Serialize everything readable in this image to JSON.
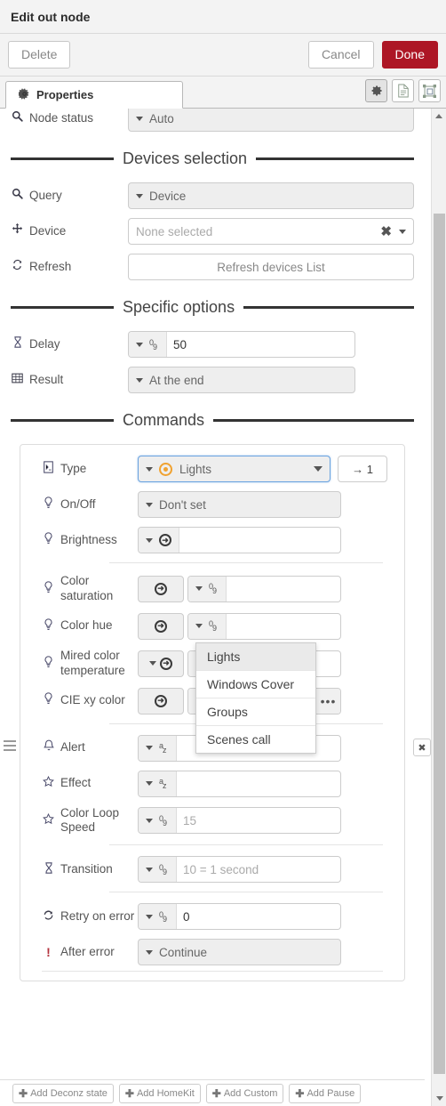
{
  "dialog": {
    "title": "Edit out node",
    "buttons": {
      "delete": "Delete",
      "cancel": "Cancel",
      "done": "Done"
    },
    "accent_color": "#ad1625"
  },
  "tabs": {
    "items": [
      {
        "label": "Properties",
        "icon": "gear-icon",
        "active": true
      }
    ],
    "tools": [
      {
        "name": "appearance-gear-icon",
        "active": true
      },
      {
        "name": "description-doc-icon",
        "active": false
      },
      {
        "name": "node-outline-icon",
        "active": false
      }
    ]
  },
  "form": {
    "node_status": {
      "label": "Node status",
      "icon": "search-icon",
      "value": "Auto"
    },
    "sections": [
      {
        "title": "Devices selection"
      },
      {
        "title": "Specific options"
      },
      {
        "title": "Commands"
      }
    ],
    "devices": {
      "query": {
        "label": "Query",
        "icon": "search-icon",
        "value": "Device"
      },
      "device": {
        "label": "Device",
        "icon": "move-icon",
        "placeholder": "None selected",
        "clear_icon": "close-icon"
      },
      "refresh": {
        "label": "Refresh",
        "icon": "refresh-icon",
        "button_label": "Refresh devices List"
      }
    },
    "specific": {
      "delay": {
        "label": "Delay",
        "icon": "hourglass-icon",
        "type": "num",
        "value": "50"
      },
      "result": {
        "label": "Result",
        "icon": "table-icon",
        "value": "At the end"
      }
    }
  },
  "command": {
    "type": {
      "label": "Type",
      "icon": "command-icon",
      "value": "Lights",
      "badge_icon": "deconz-orb-icon",
      "focused": true,
      "options": [
        "Lights",
        "Windows Cover",
        "Groups",
        "Scenes call"
      ],
      "selected_option": "Lights"
    },
    "goto_button": "→ 1",
    "rows": [
      {
        "label": "On/Off",
        "icon": "bulb-icon",
        "kind": "select",
        "value": "Don't set"
      },
      {
        "label": "Brightness",
        "icon": "bulb-icon",
        "kind": "select-arrow",
        "arrow_icon": "arrow-circle-icon",
        "value": ""
      },
      {
        "label": "Color saturation",
        "icon": "bulb-icon",
        "kind": "action-num",
        "arrow_icon": "arrow-circle-icon",
        "value": ""
      },
      {
        "label": "Color hue",
        "icon": "bulb-icon",
        "kind": "action-num",
        "arrow_icon": "arrow-circle-icon",
        "value": ""
      },
      {
        "label": "Mired color temperature",
        "icon": "bulb-icon",
        "kind": "select-arrow-num",
        "arrow_icon": "arrow-circle-icon",
        "value": ""
      },
      {
        "label": "CIE xy color",
        "icon": "bulb-icon",
        "kind": "action-json",
        "arrow_icon": "arrow-circle-icon",
        "type_glyph": "{}",
        "value": "[]",
        "more": "•••"
      },
      {
        "label": "Alert",
        "icon": "bell-icon",
        "kind": "text",
        "type_glyph": "az",
        "value": ""
      },
      {
        "label": "Effect",
        "icon": "star-icon",
        "kind": "text",
        "type_glyph": "az",
        "value": ""
      },
      {
        "label": "Color Loop Speed",
        "icon": "star-icon",
        "kind": "num",
        "placeholder": "15",
        "value": ""
      },
      {
        "label": "Transition",
        "icon": "hourglass-icon",
        "kind": "num",
        "placeholder": "10 = 1 second",
        "value": ""
      },
      {
        "label": "Retry on error",
        "icon": "refresh-icon",
        "kind": "num",
        "value": "0"
      },
      {
        "label": "After error",
        "icon": "exclaim-icon",
        "kind": "select",
        "value": "Continue"
      }
    ],
    "delete_button": "✖",
    "drag_handle": "drag-handle-icon"
  },
  "add_bar": {
    "buttons": [
      "Add Deconz state",
      "Add HomeKit",
      "Add Custom",
      "Add Pause"
    ]
  }
}
